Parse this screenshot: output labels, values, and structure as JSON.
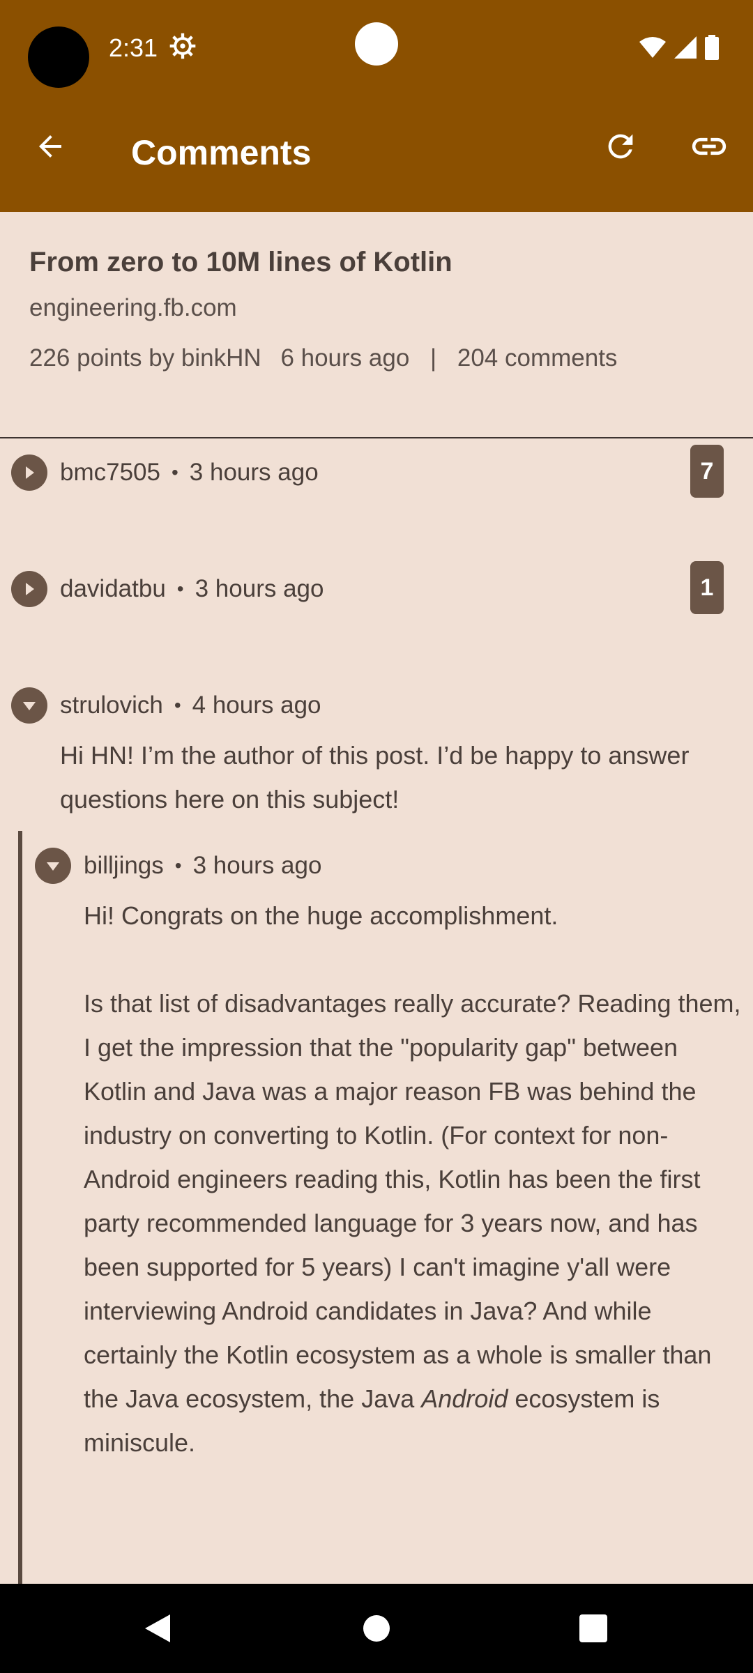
{
  "status_bar": {
    "time": "2:31"
  },
  "app_bar": {
    "title": "Comments",
    "colors": {
      "background": "#8B5000",
      "foreground": "#FFFFFF"
    },
    "icons": [
      "back-arrow-icon",
      "refresh-icon",
      "link-icon"
    ]
  },
  "story": {
    "title": "From zero to 10M lines of Kotlin",
    "domain": "engineering.fb.com",
    "points_by": "226 points by binkHN",
    "age": "6 hours ago",
    "separator": "|",
    "comments": "204 comments"
  },
  "comments": [
    {
      "author": "bmc7505",
      "dot": "•",
      "age": "3 hours ago",
      "collapsed": true,
      "replies": "7"
    },
    {
      "author": "davidatbu",
      "dot": "•",
      "age": "3 hours ago",
      "collapsed": true,
      "replies": "1"
    },
    {
      "author": "strulovich",
      "dot": "•",
      "age": "4 hours ago",
      "collapsed": false,
      "body": "Hi HN! I’m the author of this post. I’d be happy to answer questions here on this subject!"
    },
    {
      "author": "billjings",
      "dot": "•",
      "age": "3 hours ago",
      "collapsed": false,
      "body_p1": "Hi! Congrats on the huge accomplishment.",
      "body_p2_before": "Is that list of disadvantages really accurate? Reading them, I get the impression that the \"popularity gap\" between Kotlin and Java was a major reason FB was behind the industry on converting to Kotlin. (For context for non-Android engineers reading this, Kotlin has been the first party recommended language for 3 years now, and has been supported for 5 years) I can't imagine y'all were interviewing Android candidates in Java? And while certainly the Kotlin ecosystem as a whole is smaller than the Java ecosystem, the Java ",
      "body_p2_em": "Android",
      "body_p2_after": " ecosystem is miniscule."
    }
  ],
  "colors": {
    "background": "#F1E0D5",
    "accent": "#6B5547"
  }
}
